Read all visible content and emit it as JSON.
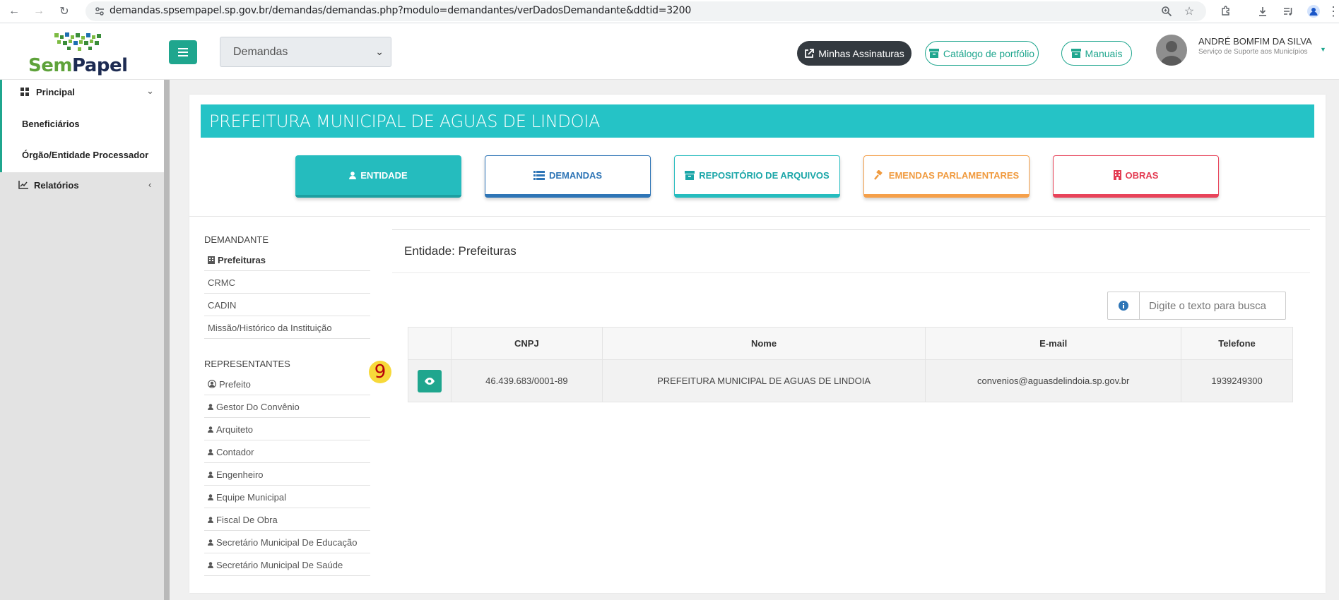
{
  "browser": {
    "url": "demandas.spsempapel.sp.gov.br/demandas/demandas.php?modulo=demandantes/verDadosDemandante&ddtid=3200"
  },
  "header": {
    "logo_text": "SemPapel",
    "select_value": "Demandas",
    "btn_assinaturas": "Minhas Assinaturas",
    "btn_catalogo": "Catálogo de portfólio",
    "btn_manuais": "Manuais",
    "user_name": "ANDRÉ BOMFIM DA SILVA",
    "user_org": "Serviço de Suporte aos Municípios"
  },
  "sidebar": {
    "principal": "Principal",
    "beneficiarios": "Beneficiários",
    "orgao": "Órgão/Entidade Processador",
    "relatorios": "Relatórios"
  },
  "banner": "PREFEITURA MUNICIPAL DE AGUAS DE LINDOIA",
  "tabs": {
    "entidade": "ENTIDADE",
    "demandas": "DEMANDAS",
    "repositorio": "REPOSITÓRIO DE ARQUIVOS",
    "emendas": "EMENDAS PARLAMENTARES",
    "obras": "OBRAS"
  },
  "left": {
    "demandante_title": "DEMANDANTE",
    "demandante_items": [
      "Prefeituras",
      "CRMC",
      "CADIN",
      "Missão/Histórico da Instituição"
    ],
    "representantes_title": "REPRESENTANTES",
    "representantes_items": [
      "Prefeito",
      "Gestor Do Convênio",
      "Arquiteto",
      "Contador",
      "Engenheiro",
      "Equipe Municipal",
      "Fiscal De Obra",
      "Secretário Municipal De Educação",
      "Secretário Municipal De Saúde"
    ]
  },
  "entity": {
    "title": "Entidade: Prefeituras",
    "search_placeholder": "Digite o texto para busca",
    "columns": [
      "CNPJ",
      "Nome",
      "E-mail",
      "Telefone"
    ],
    "row": {
      "cnpj": "46.439.683/0001-89",
      "nome": "PREFEITURA MUNICIPAL DE AGUAS DE LINDOIA",
      "email": "convenios@aguasdelindoia.sp.gov.br",
      "telefone": "1939249300"
    }
  },
  "annotation_number": "9"
}
